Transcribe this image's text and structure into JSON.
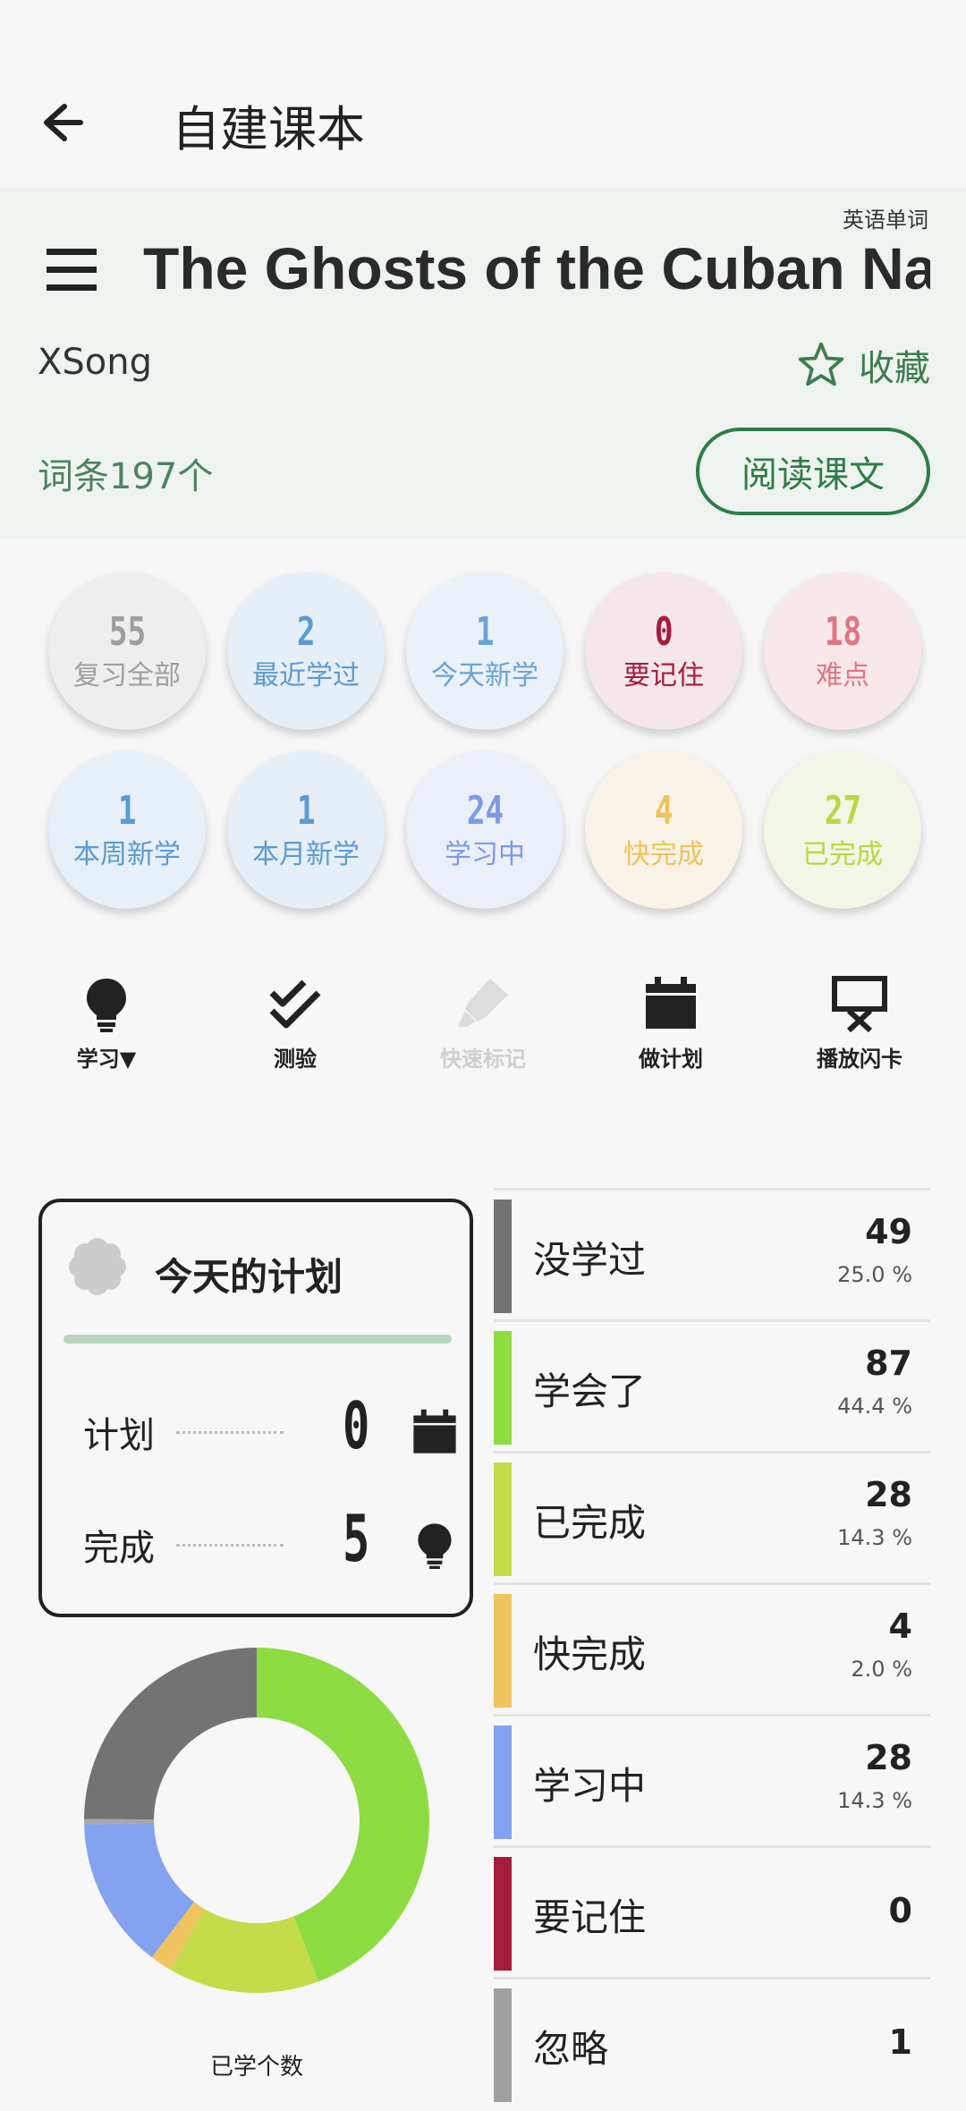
{
  "topbar": {
    "title": "自建课本"
  },
  "header": {
    "tag": "英语单词",
    "book_title": "The Ghosts of the Cuban Nation",
    "author": "XSong",
    "favorite_label": "收藏",
    "word_count": "词条197个",
    "read_label": "阅读课文"
  },
  "circles": [
    {
      "num": "55",
      "label": "复习全部",
      "bg": "#eeeeee",
      "color": "#9e9e9e"
    },
    {
      "num": "2",
      "label": "最近学过",
      "bg": "#e6eef7",
      "color": "#5c9ad2"
    },
    {
      "num": "1",
      "label": "今天新学",
      "bg": "#eaf1f8",
      "color": "#6ba3d6"
    },
    {
      "num": "0",
      "label": "要记住",
      "bg": "#f4e6ea",
      "color": "#a51c3c"
    },
    {
      "num": "18",
      "label": "难点",
      "bg": "#f8e8ea",
      "color": "#e07583"
    },
    {
      "num": "1",
      "label": "本周新学",
      "bg": "#e7eff8",
      "color": "#5c9ad2"
    },
    {
      "num": "1",
      "label": "本月新学",
      "bg": "#e6eef8",
      "color": "#5c9ad2"
    },
    {
      "num": "24",
      "label": "学习中",
      "bg": "#ebeffa",
      "color": "#7c9ae6"
    },
    {
      "num": "4",
      "label": "快完成",
      "bg": "#f8f3e6",
      "color": "#edc35a"
    },
    {
      "num": "27",
      "label": "已完成",
      "bg": "#f2f6e6",
      "color": "#b5d844"
    }
  ],
  "actions": [
    {
      "label": "学习▼",
      "icon": "lightbulb-icon",
      "enabled": true
    },
    {
      "label": "测验",
      "icon": "double-check-icon",
      "enabled": true
    },
    {
      "label": "快速标记",
      "icon": "highlighter-icon",
      "enabled": false
    },
    {
      "label": "做计划",
      "icon": "calendar-icon",
      "enabled": true
    },
    {
      "label": "播放闪卡",
      "icon": "presentation-icon",
      "enabled": true
    }
  ],
  "plan": {
    "title": "今天的计划",
    "plan_label": "计划",
    "plan_value": "0",
    "done_label": "完成",
    "done_value": "5"
  },
  "chart_data": {
    "type": "pie",
    "title": "已学个数",
    "labels": [
      "学会了",
      "已完成",
      "快完成",
      "学习中",
      "忽略",
      "没学过"
    ],
    "values": [
      87,
      28,
      4,
      28,
      1,
      49
    ],
    "colors": [
      "#8ddc42",
      "#c4dc4a",
      "#efc45e",
      "#83a3f0",
      "#a8a8a8",
      "#737373"
    ]
  },
  "stats": [
    {
      "name": "没学过",
      "count": "49",
      "pct": "25.0 %",
      "color": "#737373"
    },
    {
      "name": "学会了",
      "count": "87",
      "pct": "44.4 %",
      "color": "#8ddc42"
    },
    {
      "name": "已完成",
      "count": "28",
      "pct": "14.3 %",
      "color": "#c4dc4a"
    },
    {
      "name": "快完成",
      "count": "4",
      "pct": "2.0 %",
      "color": "#efc45e"
    },
    {
      "name": "学习中",
      "count": "28",
      "pct": "14.3 %",
      "color": "#83a3f0"
    },
    {
      "name": "要记住",
      "count": "0",
      "pct": "",
      "color": "#a51c3c"
    },
    {
      "name": "忽略",
      "count": "1",
      "pct": "",
      "color": "#a0a0a0"
    }
  ]
}
